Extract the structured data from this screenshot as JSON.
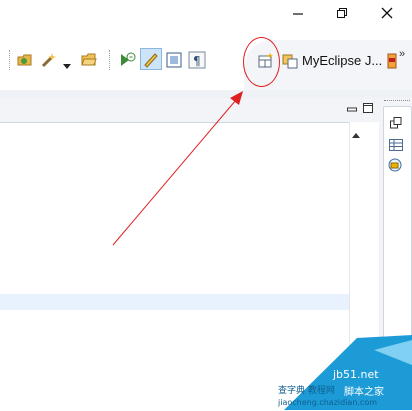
{
  "window": {
    "minimize_icon": "minimize-icon",
    "restore_icon": "restore-icon",
    "close_icon": "close-icon"
  },
  "toolbar": {
    "icons": [
      "open-folder-icon",
      "wand-icon",
      "dropdown-arrow-icon",
      "folder-icon",
      "run-icon",
      "highlight-pen-icon",
      "block-select-icon",
      "pilcrow-icon",
      "open-perspective-icon"
    ],
    "perspective_label": "MyEclipse J...",
    "overflow": "»"
  },
  "view": {
    "minimize_icon": "view-minimize-icon",
    "maximize_icon": "view-maximize-icon",
    "scroll_up_icon": "scroll-up-icon"
  },
  "right_trim": {
    "icons": [
      "restore-stack-icon",
      "table-view-icon",
      "server-icon"
    ]
  },
  "watermark": {
    "site": "jb51.net",
    "cn": "脚本之家",
    "cn2": "查字典 教程网",
    "url": "jiaocheng.chazidian.com"
  },
  "colors": {
    "annotation": "#e02020",
    "highlight_line": "#e8f2fe",
    "watermark": "#1d9bd7"
  }
}
